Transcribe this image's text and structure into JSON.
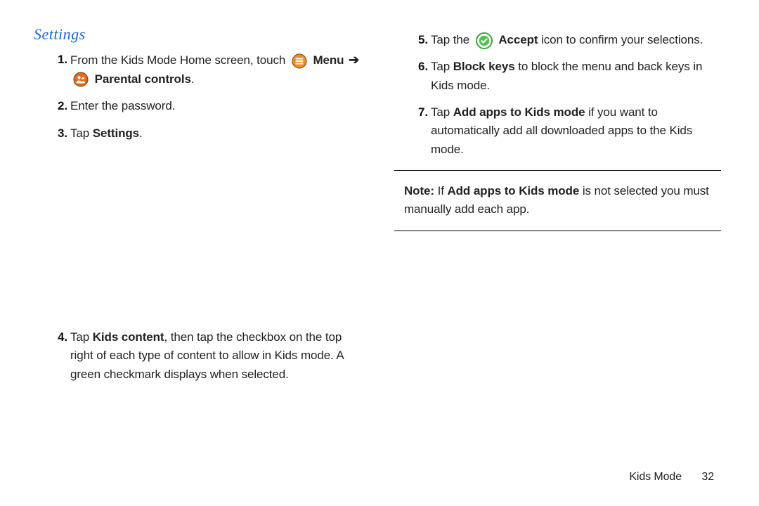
{
  "heading": "Settings",
  "left": {
    "s1a": "From the Kids Mode Home screen, touch",
    "s1_menu": "Menu",
    "s1_arrow": "➔",
    "s1_parental": "Parental controls",
    "s1_period": ".",
    "s2": "Enter the password.",
    "s3_tap": "Tap ",
    "s3_settings": "Settings",
    "s3_period": ".",
    "s4_a": "Tap ",
    "s4_b": "Kids content",
    "s4_c": ", then tap the checkbox on the top right of each type of content to allow in Kids mode. A green checkmark displays when selected."
  },
  "right": {
    "s5_a": "Tap the",
    "s5_b": "Accept",
    "s5_c": " icon to confirm your selections.",
    "s6_a": "Tap ",
    "s6_b": "Block keys",
    "s6_c": " to block the menu and back keys in Kids mode.",
    "s7_a": "Tap ",
    "s7_b": "Add apps to Kids mode",
    "s7_c": " if you want to automatically add all downloaded apps to the Kids mode.",
    "note_label": "Note:",
    "note_a": " If ",
    "note_b": "Add apps to Kids mode",
    "note_c": " is not selected you must manually add each app."
  },
  "footer": {
    "section": "Kids Mode",
    "page": "32"
  }
}
